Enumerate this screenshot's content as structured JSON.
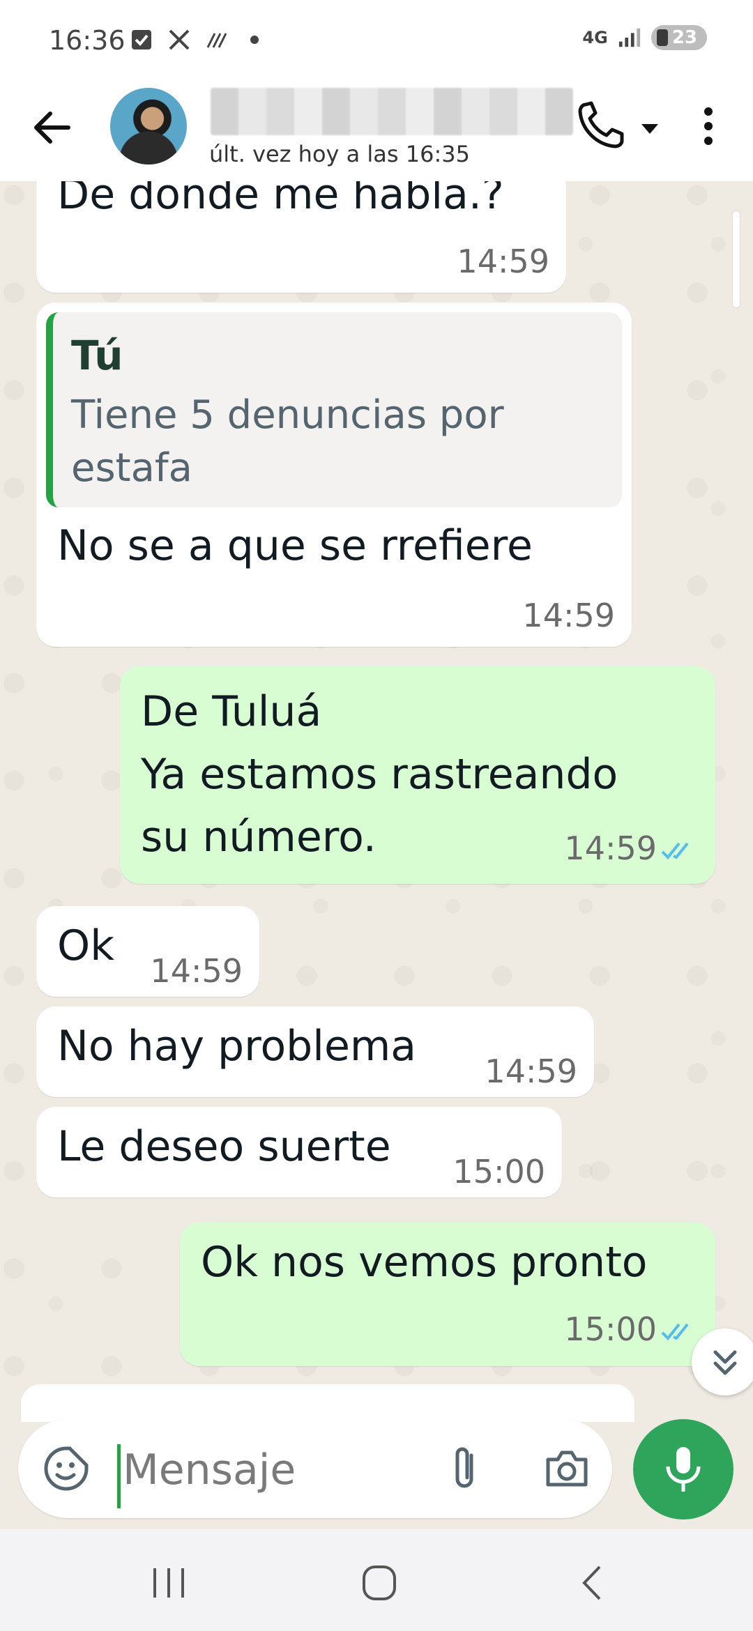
{
  "status_bar": {
    "time": "16:36",
    "network": "4G",
    "battery": "23"
  },
  "header": {
    "last_seen": "últ. vez hoy a las 16:35"
  },
  "messages": [
    {
      "direction": "in",
      "text": "De donde me habla.?",
      "time": "14:59"
    },
    {
      "direction": "in",
      "reply_to": {
        "author": "Tú",
        "text": "Tiene 5 denuncias por estafa"
      },
      "text": "No se a que se rrefiere",
      "time": "14:59"
    },
    {
      "direction": "out",
      "lines": [
        "De Tuluá",
        "Ya estamos rastreando",
        "su número."
      ],
      "time": "14:59",
      "status": "read"
    },
    {
      "direction": "in",
      "text": "Ok",
      "time": "14:59"
    },
    {
      "direction": "in",
      "text": "No hay problema",
      "time": "14:59"
    },
    {
      "direction": "in",
      "text": "Le deseo suerte",
      "time": "15:00"
    },
    {
      "direction": "out",
      "text": "Ok nos vemos pronto",
      "time": "15:00",
      "status": "read"
    }
  ],
  "composer": {
    "placeholder": "Mensaje"
  },
  "colors": {
    "incoming_bubble": "#ffffff",
    "outgoing_bubble": "#d9fdd3",
    "accent": "#25a244",
    "read_ticks": "#53bdeb",
    "chat_background": "#efeae2"
  },
  "icons": [
    "arrow-left-icon",
    "phone-icon",
    "caret-down-icon",
    "more-vertical-icon",
    "sticker-icon",
    "paperclip-icon",
    "camera-icon",
    "microphone-icon",
    "chevrons-down-icon",
    "recents-icon",
    "home-icon",
    "back-icon"
  ]
}
